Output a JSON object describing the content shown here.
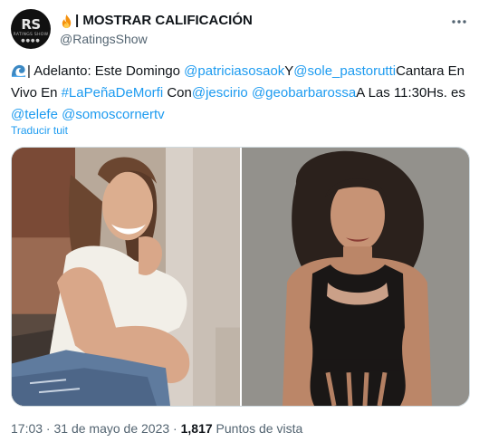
{
  "author": {
    "display_name": "| MOSTRAR CALIFICACIÓN",
    "handle": "@RatingsShow",
    "avatar_text": "RS",
    "avatar_subtext": "RATINGS SHOW",
    "avatar_dots": "●●●●"
  },
  "tweet": {
    "parts": [
      {
        "text": "| Adelanto: Este Domingo ",
        "link": false
      },
      {
        "text": "@patriciasosaok",
        "link": true
      },
      {
        "text": "Y",
        "link": false
      },
      {
        "text": "@sole_pastorutti",
        "link": true
      },
      {
        "text": "Cantara En Vivo En ",
        "link": false
      },
      {
        "text": "#LaPeñaDeMorfi",
        "link": true
      },
      {
        "text": " Con",
        "link": false
      },
      {
        "text": "@jescirio",
        "link": true
      },
      {
        "text": " ",
        "link": false
      },
      {
        "text": "@geobarbarossa",
        "link": true
      },
      {
        "text": "A Las 11:30Hs. es ",
        "link": false
      },
      {
        "text": "@telefe",
        "link": true
      },
      {
        "text": " ",
        "link": false
      },
      {
        "text": "@somoscornertv",
        "link": true
      }
    ],
    "translate_label": "Traducir tuit"
  },
  "meta": {
    "time": "17:03",
    "separator": " · ",
    "date": "31 de mayo de 2023",
    "views_count": "1,817",
    "views_label": " Puntos de vista"
  },
  "icons": {
    "fire": "fire-icon",
    "wave": "wave-icon",
    "more": "more-options-icon"
  },
  "colors": {
    "link": "#1d9bf0",
    "secondary": "#536471",
    "primary": "#0f1419"
  }
}
